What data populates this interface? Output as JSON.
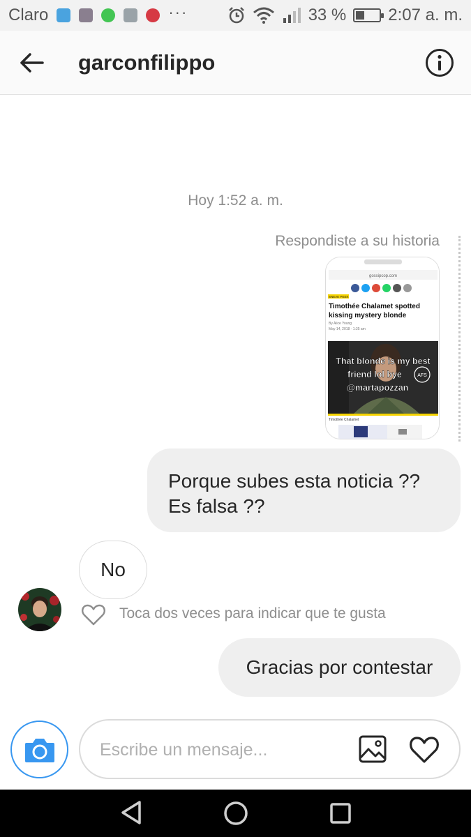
{
  "status_bar": {
    "carrier": "Claro",
    "battery_percent": "33 %",
    "battery_level": 0.33,
    "time": "2:07 a. m.",
    "overflow": "···",
    "icons": [
      "sim-notification-icon",
      "photo-notification-icon",
      "whatsapp-icon",
      "gallery-notification-icon",
      "pinterest-icon",
      "alarm-icon",
      "wifi-icon",
      "signal-icon",
      "battery-icon"
    ]
  },
  "header": {
    "username": "garconfilippo",
    "back_icon": "arrow-left-icon",
    "info_icon": "info-icon"
  },
  "chat": {
    "timestamp": "Hoy 1:52 a. m.",
    "story_reply_label": "Respondiste a su historia",
    "story": {
      "url": "gossipcop.com",
      "headline": "Timothée Chalamet spotted kissing mystery blonde",
      "byline": "By Alice Young",
      "date": "May 14, 2018 · 1:35 am",
      "overlay_line1": "That blonde is my best",
      "overlay_line2": "friend lol bye",
      "overlay_line3": "@martapozzan",
      "badge": "AFS",
      "caption": "Timothée Chalamet",
      "tag": "SNEAK PEEK"
    },
    "messages": [
      {
        "from": "me",
        "text_line1": "Porque subes esta noticia ??",
        "text_line2": "Es falsa ??"
      },
      {
        "from": "them",
        "text": "No"
      },
      {
        "from": "me",
        "text": "Gracias por contestar"
      }
    ],
    "like_hint": "Toca dos veces para indicar que te gusta"
  },
  "composer": {
    "placeholder": "Escribe un mensaje...",
    "camera_icon": "camera-icon",
    "gallery_icon": "gallery-icon",
    "heart_icon": "heart-icon"
  },
  "colors": {
    "accent": "#3897f0",
    "bubble": "#efefef",
    "muted_text": "#8e8e8e"
  }
}
